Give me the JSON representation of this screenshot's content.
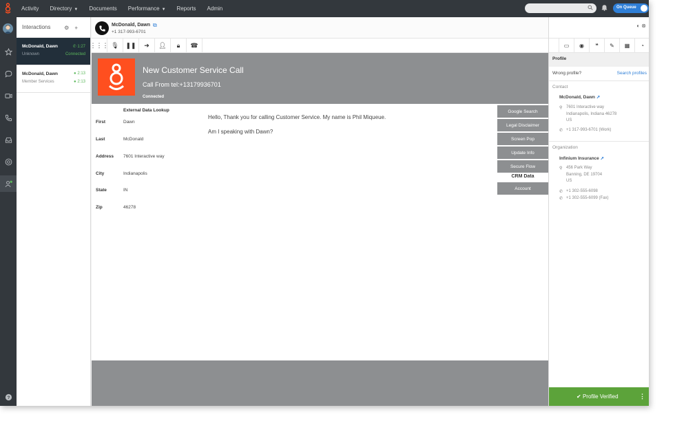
{
  "topnav": {
    "items": [
      {
        "label": "Activity",
        "caret": false
      },
      {
        "label": "Directory",
        "caret": true
      },
      {
        "label": "Documents",
        "caret": false
      },
      {
        "label": "Performance",
        "caret": true
      },
      {
        "label": "Reports",
        "caret": false
      },
      {
        "label": "Admin",
        "caret": false
      }
    ],
    "search_placeholder": "",
    "queue_label": "On Queue"
  },
  "interactions": {
    "title": "Interactions",
    "cards": [
      {
        "name": "McDonald, Dawn",
        "sub": "Unknown",
        "time": "1:27",
        "status": "Connected",
        "active": true
      },
      {
        "name": "McDonald, Dawn",
        "sub": "Member Services",
        "time": "2:13",
        "status": "2:13",
        "active": false
      }
    ]
  },
  "call": {
    "caller_name": "McDonald, Dawn",
    "caller_number": "+1 317-993-6701",
    "banner_title": "New Customer Service Call",
    "banner_from": "Call From tel:+13179936701",
    "banner_status": "Connected"
  },
  "lookup": {
    "title": "External Data Lookup",
    "fields": [
      {
        "label": "First",
        "value": "Dawn"
      },
      {
        "label": "Last",
        "value": "McDonald"
      },
      {
        "label": "Address",
        "value": "7601 Interactive way"
      },
      {
        "label": "City",
        "value": "Indianapolis"
      },
      {
        "label": "State",
        "value": "IN"
      },
      {
        "label": "Zip",
        "value": "46278"
      }
    ]
  },
  "script": {
    "line1": "Hello, Thank you for calling Customer Service. My name is Phil Miqueue.",
    "line2": "Am I speaking with Dawn?"
  },
  "actions": {
    "buttons_top": [
      "Google Search",
      "Legal Disclaimer",
      "Screen Pop",
      "Update Info",
      "Secure Flow"
    ],
    "crm_label": "CRM Data",
    "buttons_bottom": [
      "Account"
    ]
  },
  "profile": {
    "title": "Profile",
    "wrong_profile": "Wrong profile?",
    "search_profiles": "Search profiles",
    "contact_heading": "Contact",
    "contact_name": "McDonald, Dawn",
    "contact_address": [
      "7601 Interactive way",
      "Indianapolis, Indiana 46278",
      "US"
    ],
    "contact_phone": "+1 317-993-6701",
    "contact_phone_type": "(Work)",
    "org_heading": "Organization",
    "org_name": "Infinium Insurance",
    "org_address": [
      "456 Park Way",
      "Banning, DE 19704",
      "US"
    ],
    "org_phone": "+1 302-555-6098",
    "org_fax": "+1 302-555-6099 (Fax)",
    "verified_label": "Profile Verified"
  },
  "colors": {
    "accent": "#2f7fd7",
    "brand": "#ff4f1f",
    "verified": "#5ca33a",
    "nav_bg": "#33383d"
  }
}
